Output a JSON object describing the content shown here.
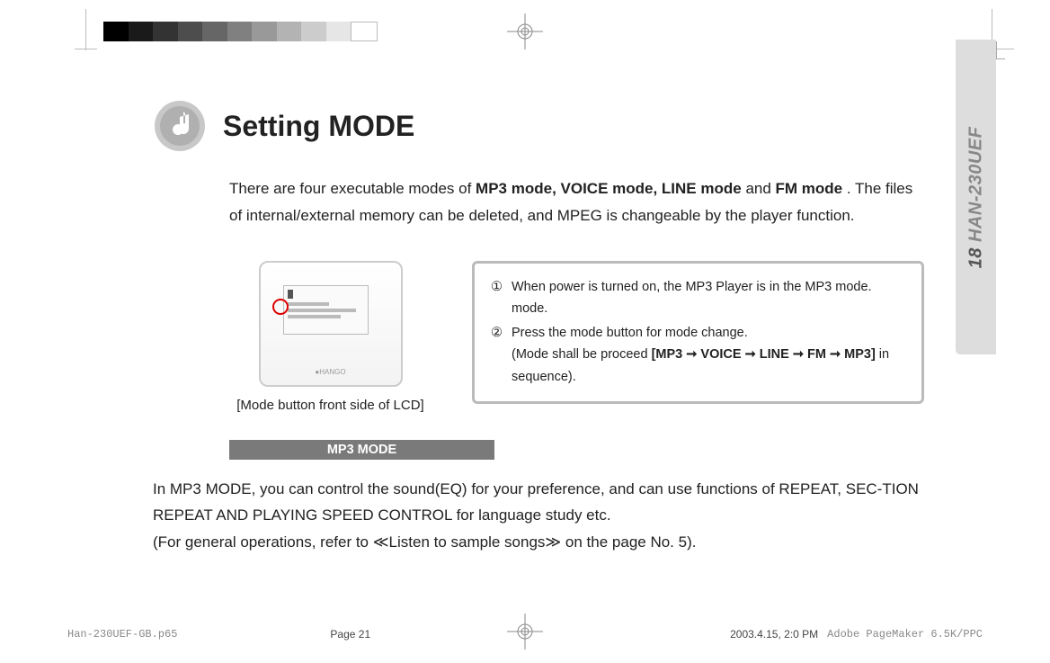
{
  "title": "Setting MODE",
  "intro_prefix": "There are four executable modes of ",
  "intro_bold": "MP3 mode, VOICE mode, LINE mode",
  "intro_mid": " and ",
  "intro_bold2": "FM mode",
  "intro_suffix": " . The files of internal/external memory can be deleted, and MPEG is changeable by the player function.",
  "device_caption": "[Mode button front side of LCD]",
  "instr": {
    "n1": "①",
    "t1": "When power is turned on, the MP3 Player is in the MP3 mode. mode.",
    "n2": "②",
    "t2a": "Press the mode button for mode change.",
    "t2b_prefix": "(Mode shall be proceed ",
    "t2b_bold": "[MP3 ➞ VOICE ➞ LINE  ➞  FM ➞ MP3]",
    "t2b_suffix": " in sequence)."
  },
  "section_header": "MP3 MODE",
  "body_p1": "In MP3 MODE, you can control the sound(EQ) for your preference, and can use functions of REPEAT, SEC-TION REPEAT AND PLAYING SPEED CONTROL for language study etc.",
  "body_p2": "(For general operations, refer to ≪Listen to sample songs≫ on the page No. 5).",
  "side_tab_page": "18",
  "side_tab_model": " HAN-230UEF",
  "footer": {
    "file": "Han-230UEF-GB.p65",
    "page": "Page 21",
    "date": "2003.4.15, 2:0 PM",
    "app": "Adobe PageMaker 6.5K/PPC"
  }
}
